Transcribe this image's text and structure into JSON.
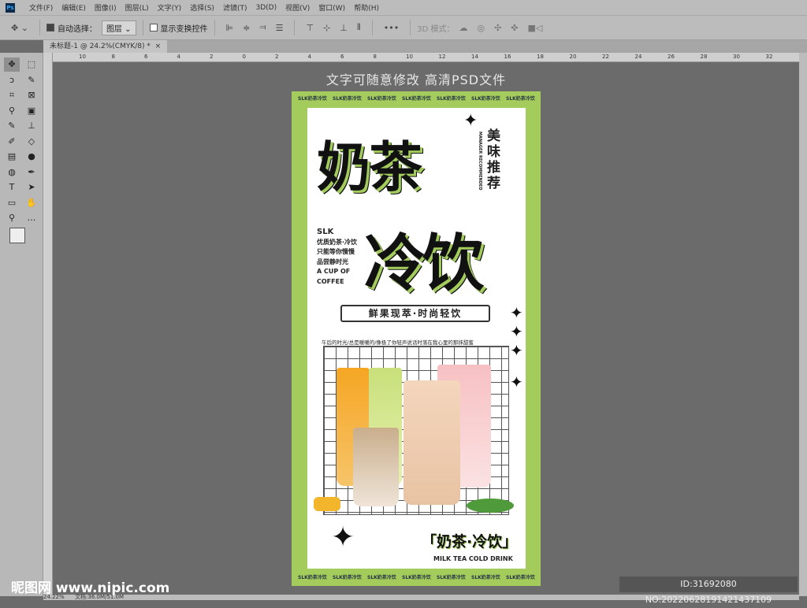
{
  "app": {
    "logo": "Ps"
  },
  "menu": [
    "文件(F)",
    "编辑(E)",
    "图像(I)",
    "图层(L)",
    "文字(Y)",
    "选择(S)",
    "滤镜(T)",
    "3D(D)",
    "视图(V)",
    "窗口(W)",
    "帮助(H)"
  ],
  "options": {
    "auto_select_label": "自动选择：",
    "auto_select_checked": true,
    "layer_select": "图层",
    "show_transform_label": "显示变换控件",
    "show_transform_checked": false,
    "more": "•••",
    "mode_3d": "3D 模式："
  },
  "document_tab": {
    "title": "未标题-1 @ 24.2%(CMYK/8) *",
    "close": "×"
  },
  "ruler_h": [
    "10",
    "8",
    "6",
    "4",
    "2",
    "0",
    "2",
    "4",
    "6",
    "8",
    "10",
    "12",
    "14",
    "16",
    "18",
    "20",
    "22",
    "24",
    "26",
    "28",
    "30",
    "32"
  ],
  "status": {
    "zoom": "24.22%",
    "doc": "文档:36.0M/51.0M"
  },
  "canvas_hint": "文字可随意修改 高清PSD文件",
  "poster": {
    "title1": "奶茶",
    "title2": "冷饮",
    "side_title": "美味推荐",
    "side_en": "MANAGER RECOMMENDED",
    "left_lines": [
      "SLK",
      "优质奶茶·冷饮",
      "只能等你慢慢",
      "品尝静时光",
      "A CUP OF",
      "COFFEE"
    ],
    "banner": "鲜果现萃·时尚轻饮",
    "tagline": "午后的时光/总是暖暖的/像极了你轻声说话时落在我心里的那抹甜蜜",
    "bottom_title": "「奶茶·冷饮」",
    "bottom_en": "MILK TEA COLD DRINK",
    "border_pattern": "SLK奶茶冷饮",
    "colors": {
      "accent": "#a3cc5c",
      "ink": "#111111"
    }
  },
  "watermark": {
    "site": "昵图网 www.nipic.com",
    "id": "ID:31692080 NO:20220628191421437109"
  }
}
